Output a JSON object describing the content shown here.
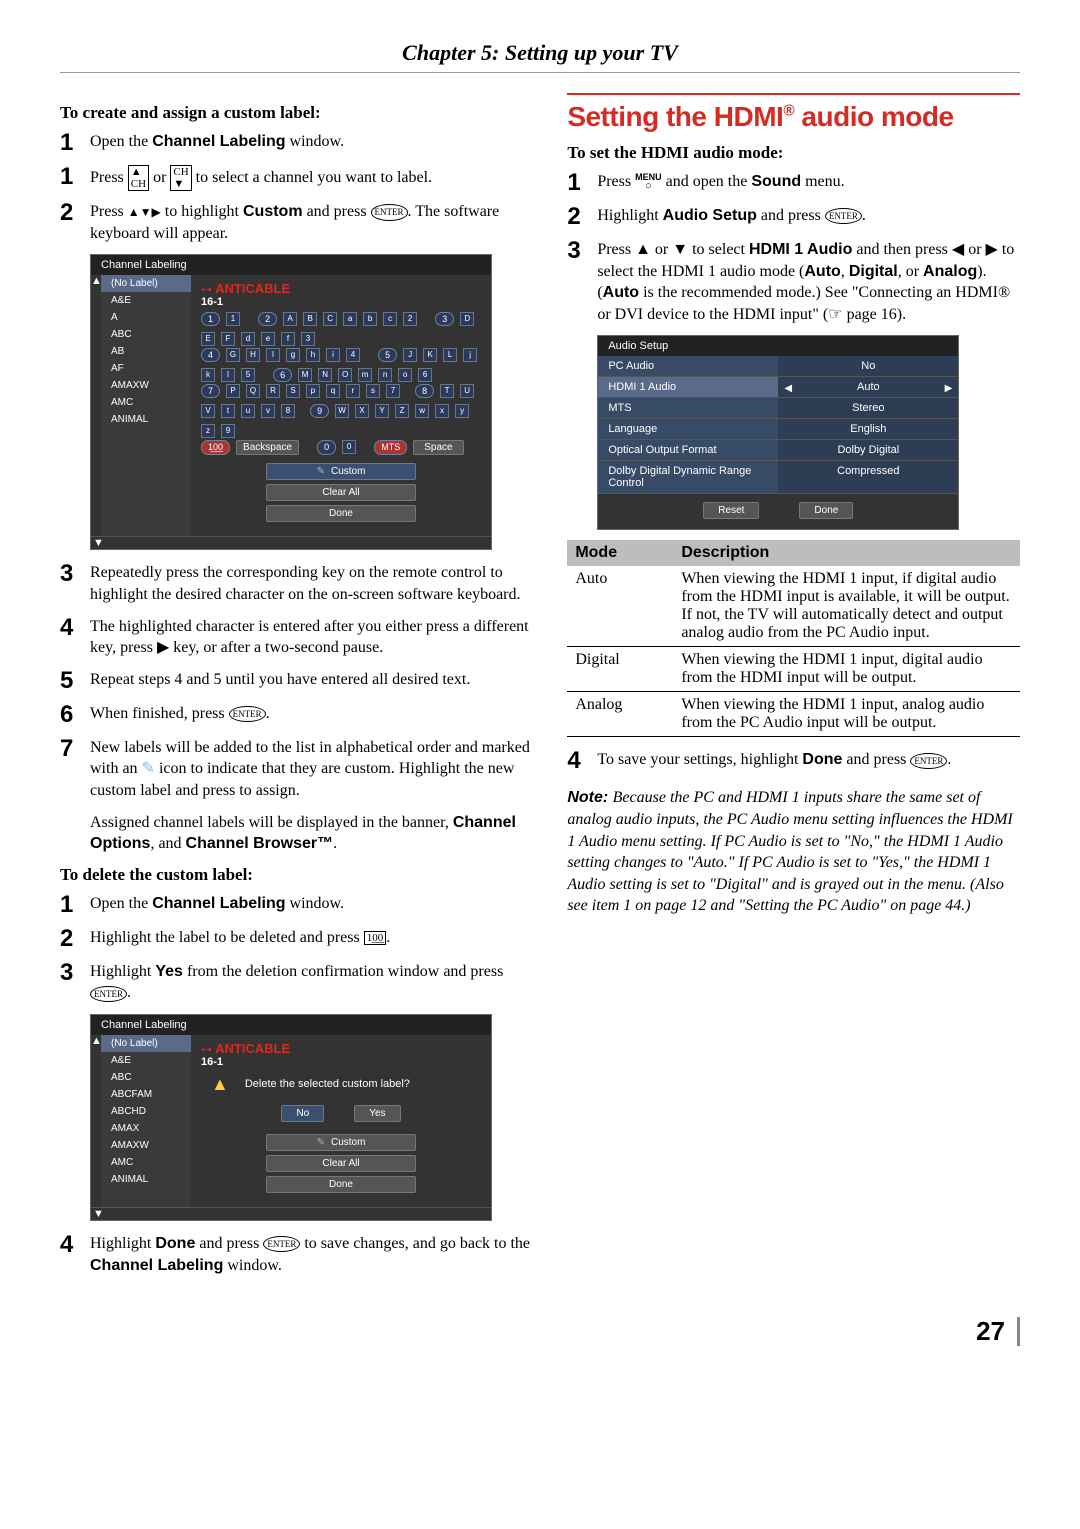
{
  "chapter_title": "Chapter 5: Setting up your TV",
  "page_number": "27",
  "left": {
    "h_create": "To create and assign a custom label:",
    "step1a_pre": "Open the ",
    "step1a_bold": "Channel Labeling",
    "step1a_post": " window.",
    "step1b": "Press ",
    "step1b_post": " to select a channel you want to label.",
    "step2_pre": "Press ",
    "step2_mid": " to highlight ",
    "step2_bold": "Custom",
    "step2_mid2": " and press ",
    "step2_post": ". The software keyboard will appear.",
    "step3": "Repeatedly press the corresponding key on the remote control to highlight the desired character on the on-screen software keyboard.",
    "step4": "The highlighted character is entered after you either press a different key, press ▶ key, or after a two-second pause.",
    "step5": "Repeat steps 4 and 5 until you have entered all desired text.",
    "step6_pre": "When finished, press ",
    "step6_post": ".",
    "step7_a": "New labels will be added to the list in alphabetical order and marked with an ",
    "step7_b": " icon to indicate that they are custom. Highlight the new custom label and press to assign.",
    "assigned_note_pre": "Assigned channel labels will be displayed in the banner, ",
    "assigned_b1": "Channel Options",
    "assigned_mid": ", and ",
    "assigned_b2": "Channel Browser™",
    "assigned_post": ".",
    "h_delete": "To delete the custom label:",
    "d1_pre": "Open the ",
    "d1_bold": "Channel Labeling",
    "d1_post": " window.",
    "d2_pre": "Highlight the label to be deleted and press ",
    "d2_post": ".",
    "d3_pre": "Highlight ",
    "d3_bold": "Yes",
    "d3_mid": " from the deletion confirmation window and press ",
    "d3_post": ".",
    "d4_pre": "Highlight ",
    "d4_bold1": "Done",
    "d4_mid1": " and press ",
    "d4_mid2": " to save changes, and go back to the ",
    "d4_bold2": "Channel Labeling",
    "d4_post": " window.",
    "osd1": {
      "title": "Channel Labeling",
      "sidebar": [
        "(No Label)",
        "A&E",
        "A",
        "ABC",
        "AB",
        "AF",
        "AMAXW",
        "AMC",
        "ANIMAL"
      ],
      "head_label": "ANTICABLE",
      "head_sub": "16-1",
      "row1": [
        "1",
        "1"
      ],
      "row1b": [
        "2",
        "A",
        "B",
        "C",
        "a",
        "b",
        "c",
        "2"
      ],
      "row1c": [
        "3",
        "D",
        "E",
        "F",
        "d",
        "e",
        "f",
        "3"
      ],
      "row2": [
        "4",
        "G",
        "H",
        "I",
        "g",
        "h",
        "i",
        "4"
      ],
      "row2b": [
        "5",
        "J",
        "K",
        "L",
        "j",
        "k",
        "l",
        "5"
      ],
      "row2c": [
        "6",
        "M",
        "N",
        "O",
        "m",
        "n",
        "o",
        "6"
      ],
      "row3": [
        "7",
        "P",
        "Q",
        "R",
        "S",
        "p",
        "q",
        "r",
        "s",
        "7"
      ],
      "row3b": [
        "8",
        "T",
        "U",
        "V",
        "t",
        "u",
        "v",
        "8"
      ],
      "row3c": [
        "9",
        "W",
        "X",
        "Y",
        "Z",
        "w",
        "x",
        "y",
        "z",
        "9"
      ],
      "row4a": "Backspace",
      "row4b": [
        "0",
        "0"
      ],
      "row4c": "Space",
      "btn_custom": "Custom",
      "btn_clear": "Clear All",
      "btn_done": "Done"
    },
    "osd2": {
      "title": "Channel Labeling",
      "sidebar": [
        "(No Label)",
        "A&E",
        "ABC",
        "ABCFAM",
        "ABCHD",
        "AMAX",
        "AMAXW",
        "AMC",
        "ANIMAL"
      ],
      "head_label": "ANTICABLE",
      "head_sub": "16-1",
      "warn_text": "Delete the selected custom label?",
      "btn_no": "No",
      "btn_yes": "Yes",
      "btn_custom": "Custom",
      "btn_clear": "Clear All",
      "btn_done": "Done"
    }
  },
  "right": {
    "section_title_a": "Setting the HDMI",
    "section_title_b": " audio mode",
    "h_set": "To set the HDMI audio mode:",
    "r1_pre": "Press ",
    "r1_mid": " and open the ",
    "r1_bold": "Sound",
    "r1_post": " menu.",
    "r2_pre": "Highlight ",
    "r2_bold": "Audio Setup",
    "r2_mid": " and press ",
    "r2_post": ".",
    "r3_a": "Press ▲ or ▼ to select ",
    "r3_bold1": "HDMI 1 Audio",
    "r3_b": " and then press ◀ or ▶ to select the HDMI 1 audio mode (",
    "r3_bold2": "Auto",
    "r3_c": ", ",
    "r3_bold3": "Digital",
    "r3_d": ", or ",
    "r3_bold4": "Analog",
    "r3_e": "). (",
    "r3_bold5": "Auto",
    "r3_f": " is the recommended mode.) See \"Connecting an HDMI® or DVI device to the HDMI input\" (☞ page 16).",
    "r4_pre": "To save your settings, highlight ",
    "r4_bold": "Done",
    "r4_mid": " and press ",
    "r4_post": ".",
    "osd3": {
      "title": "Audio Setup",
      "rows": [
        {
          "k": "PC Audio",
          "v": "No"
        },
        {
          "k": "HDMI 1 Audio",
          "v": "Auto",
          "sel": true
        },
        {
          "k": "MTS",
          "v": "Stereo"
        },
        {
          "k": "Language",
          "v": "English"
        },
        {
          "k": "Optical Output Format",
          "v": "Dolby Digital"
        },
        {
          "k": "Dolby Digital Dynamic Range Control",
          "v": "Compressed"
        }
      ],
      "btn_reset": "Reset",
      "btn_done": "Done"
    },
    "modetbl": {
      "h1": "Mode",
      "h2": "Description",
      "rows": [
        {
          "m": "Auto",
          "d": "When viewing the HDMI 1 input, if digital audio from the HDMI input is available, it will be output. If not, the TV will automatically detect and output analog audio from the PC Audio input."
        },
        {
          "m": "Digital",
          "d": "When viewing the HDMI 1 input, digital audio from the HDMI input will be output."
        },
        {
          "m": "Analog",
          "d": "When viewing the HDMI 1 input, analog audio from the PC Audio input will be output."
        }
      ]
    },
    "note": "Because the PC and HDMI 1 inputs share the same set of analog audio inputs, the PC Audio menu setting influences the HDMI 1 Audio menu setting. If PC Audio is set to \"No,\" the HDMI 1 Audio setting changes to \"Auto.\" If PC Audio is set to \"Yes,\" the HDMI 1 Audio setting is set to \"Digital\" and is grayed out in the menu. (Also see item 1 on page 12 and \"Setting the PC Audio\" on page 44.)",
    "note_lead": "Note: "
  },
  "icons": {
    "ch_up": "▲CH",
    "ch_dn": "CH▼",
    "enter": "ENTER",
    "menu_top": "MENU",
    "hundred": "1͟0͟0",
    "pencil": "✎",
    "remote_hand": "☞"
  }
}
